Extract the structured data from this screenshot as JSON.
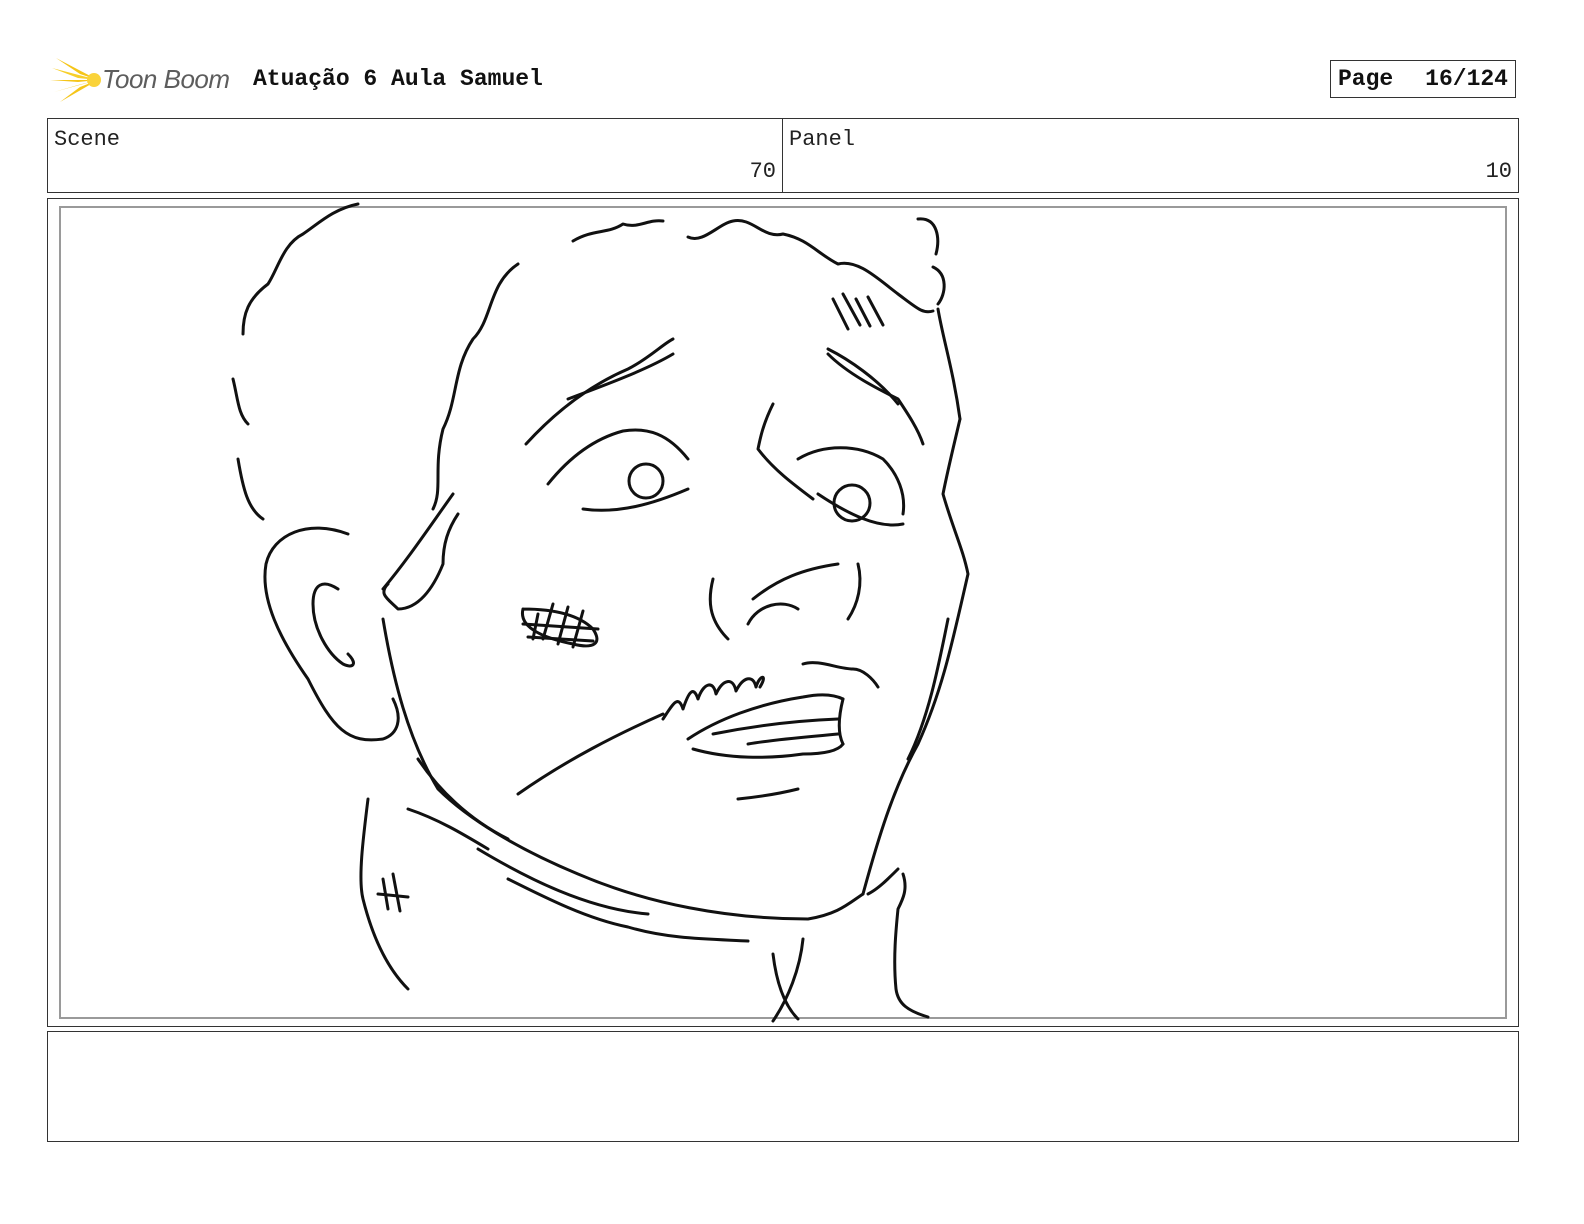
{
  "header": {
    "logo_text": "Toon Boom",
    "project_title": "Atuação 6 Aula Samuel",
    "page_label": "Page",
    "page_number": "16/124"
  },
  "info": {
    "scene_label": "Scene",
    "scene_value": "70",
    "panel_label": "Panel",
    "panel_value": "10"
  },
  "colors": {
    "logo_burst": "#f5c518",
    "logo_text": "#5d5d5d",
    "frame_border": "#9a9a9a",
    "ink": "#111111"
  },
  "icons": {
    "logo": "starburst-logo-icon"
  }
}
